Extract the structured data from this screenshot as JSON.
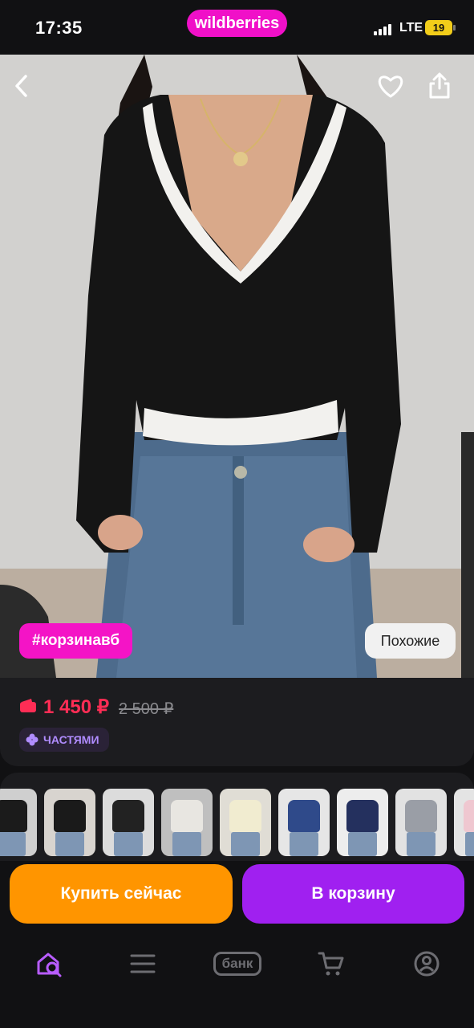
{
  "status_bar": {
    "time": "17:35",
    "network": "LTE",
    "battery": "19"
  },
  "brand": {
    "name": "wildberries",
    "color": "#f010c8"
  },
  "hero": {
    "back_icon": "chevron-left-icon",
    "favorite_icon": "heart-icon",
    "share_icon": "share-icon",
    "tag_label": "#корзинавб",
    "similar_label": "Похожие"
  },
  "price": {
    "current": "1 450 ₽",
    "old": "2 500 ₽",
    "installments_label": "ЧАСТЯМИ",
    "accent": "#ff2d55"
  },
  "recommendations": {
    "items": [
      {
        "shirt_color": "#1b1b1b",
        "bg": "#cfcfcf"
      },
      {
        "shirt_color": "#1a1a1a",
        "bg": "#d8d4cf"
      },
      {
        "shirt_color": "#222222",
        "bg": "#dcdcdc"
      },
      {
        "shirt_color": "#e8e6e1",
        "bg": "#bfbfbf"
      },
      {
        "shirt_color": "#f1ecd0",
        "bg": "#e0ddd5"
      },
      {
        "shirt_color": "#2f4a8a",
        "bg": "#e6e6e6"
      },
      {
        "shirt_color": "#24305e",
        "bg": "#ededed"
      },
      {
        "shirt_color": "#9a9ea6",
        "bg": "#e2e2e2"
      },
      {
        "shirt_color": "#efc7d0",
        "bg": "#e4e4e4"
      }
    ]
  },
  "actions": {
    "buy_now": "Купить сейчас",
    "add_to_cart": "В корзину"
  },
  "bottom_nav": {
    "items": [
      {
        "icon": "home-search-icon",
        "active": true
      },
      {
        "icon": "menu-icon"
      },
      {
        "label": "банк",
        "icon": "bank-icon"
      },
      {
        "icon": "cart-icon"
      },
      {
        "icon": "profile-icon"
      }
    ]
  }
}
